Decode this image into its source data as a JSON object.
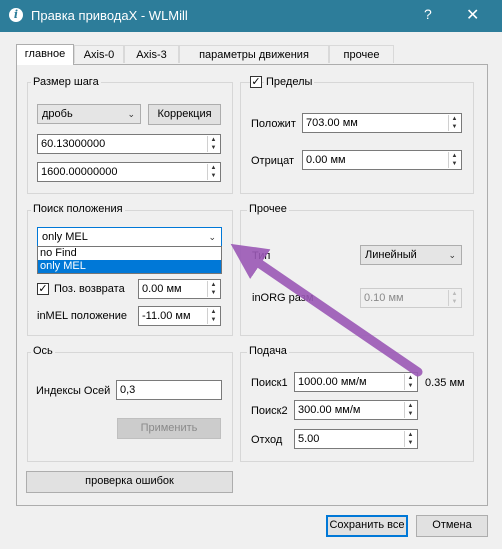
{
  "window": {
    "title": "Правка приводаX - WLMill",
    "help": "?",
    "close": "✕"
  },
  "tabs": [
    "главное",
    "Axis-0",
    "Axis-3",
    "параметры движения",
    "прочее"
  ],
  "step_group": {
    "title": "Размер шага",
    "mode_value": "дробь",
    "correction_button": "Коррекция",
    "value1": "60.13000000",
    "value2": "1600.00000000"
  },
  "limits_group": {
    "title": "Пределы",
    "checked": true,
    "positive_label": "Положит",
    "positive_value": "703.00 мм",
    "negative_label": "Отрицат",
    "negative_value": "0.00 мм"
  },
  "search_group": {
    "title": "Поиск положения",
    "combo_value": "only MEL",
    "options": [
      "no Find",
      "only MEL"
    ],
    "selected_option_index": 1,
    "return_pos_label": "Поз. возврата",
    "return_pos_checked": true,
    "return_pos_value": "0.00 мм",
    "inmel_label": "inMEL положение",
    "inmel_value": "-11.00 мм"
  },
  "other_group": {
    "title": "Прочее",
    "type_label": "Тип",
    "type_value": "Линейный",
    "inorg_label": "inORG разм",
    "inorg_value": "0.10 мм"
  },
  "axis_group": {
    "title": "Ось",
    "indices_label": "Индексы Осей",
    "indices_value": "0,3",
    "apply_button": "Применить"
  },
  "feed_group": {
    "title": "Подача",
    "search1_label": "Поиск1",
    "search1_value": "1000.00 мм/м",
    "search1_extra": "0.35 мм",
    "search2_label": "Поиск2",
    "search2_value": "300.00 мм/м",
    "retract_label": "Отход",
    "retract_value": "5.00"
  },
  "error_check_button": "проверка ошибок",
  "footer": {
    "save_button": "Сохранить все",
    "cancel_button": "Отмена"
  },
  "colors": {
    "titlebar": "#2d7d9a",
    "focus": "#0078d7",
    "annotation_arrow": "#9b59b6"
  }
}
